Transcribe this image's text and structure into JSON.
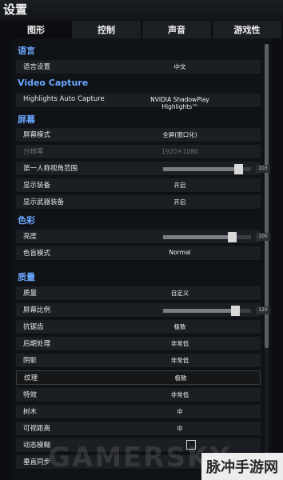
{
  "window": {
    "title": "设置"
  },
  "tabs": [
    {
      "label": "图形",
      "active": true
    },
    {
      "label": "控制",
      "active": false
    },
    {
      "label": "声音",
      "active": false
    },
    {
      "label": "游戏性",
      "active": false
    }
  ],
  "sections": {
    "language": "语言",
    "video_capture": "Video Capture",
    "screen": "屏幕",
    "color": "色彩",
    "quality": "质量"
  },
  "rows": {
    "language_setting": {
      "label": "语言设置",
      "value": "中文"
    },
    "highlights_auto_capture": {
      "label": "Highlights Auto Capture",
      "value": "NVIDIA ShadowPlay Highlights™"
    },
    "screen_mode": {
      "label": "屏幕模式",
      "value": "全屏(窗口化)"
    },
    "resolution": {
      "label": "分辨率",
      "value": "1920＊1080"
    },
    "fpp_fov": {
      "label": "第一人称视角范围",
      "slider_value": "103",
      "level": 0.85
    },
    "show_equipment": {
      "label": "显示装备",
      "value": "开启"
    },
    "show_weapon_equipment": {
      "label": "显示武器装备",
      "value": "开启"
    },
    "brightness": {
      "label": "亮度",
      "slider_value": "100",
      "level": 0.78
    },
    "colorblind_mode": {
      "label": "色盲模式",
      "value": "Normal"
    },
    "quality": {
      "label": "质量",
      "value": "自定义"
    },
    "screen_scale": {
      "label": "屏幕比例",
      "slider_value": "120",
      "level": 0.82
    },
    "anti_aliasing": {
      "label": "抗锯齿",
      "value": "极致"
    },
    "post_processing": {
      "label": "后期处理",
      "value": "非常低"
    },
    "shadows": {
      "label": "阴影",
      "value": "非常低"
    },
    "textures": {
      "label": "纹理",
      "value": "极致"
    },
    "effects": {
      "label": "特效",
      "value": "非常低"
    },
    "foliage": {
      "label": "树木",
      "value": "中"
    },
    "view_distance": {
      "label": "可视距离",
      "value": "中"
    },
    "motion_blur": {
      "label": "动态模糊",
      "checked": false
    },
    "vsync": {
      "label": "垂直同步"
    }
  },
  "overlay": {
    "watermark": "GAMERSKY",
    "brand": "脉冲手游网"
  }
}
